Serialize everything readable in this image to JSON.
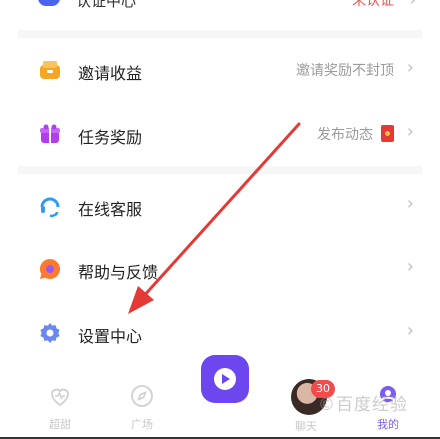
{
  "top_partial": {
    "label": "认证中心",
    "right": "未认证"
  },
  "menu": [
    {
      "key": "invite",
      "label": "邀请收益",
      "value": "邀请奖励不封顶",
      "icon": "wallet-icon",
      "color": "#f5a623"
    },
    {
      "key": "tasks",
      "label": "任务奖励",
      "value": "发布动态",
      "icon": "gift-icon",
      "color": "#b43cf0"
    },
    {
      "key": "service",
      "label": "在线客服",
      "value": "",
      "icon": "headset-icon",
      "color": "#2f9bf0"
    },
    {
      "key": "help",
      "label": "帮助与反馈",
      "value": "",
      "icon": "feedback-icon",
      "color": "#ff7a2e"
    },
    {
      "key": "settings",
      "label": "设置中心",
      "value": "",
      "icon": "gear-icon",
      "color": "#6a86f0"
    }
  ],
  "chevron": "›",
  "tabs": [
    {
      "key": "tab1",
      "label": "超甜",
      "icon": "heart-icon"
    },
    {
      "key": "tab2",
      "label": "广场",
      "icon": "compass-icon"
    },
    {
      "key": "tab4",
      "label": "聊天",
      "icon": "chat-icon",
      "badge": "30"
    },
    {
      "key": "tab5",
      "label": "我的",
      "icon": "profile-icon"
    }
  ],
  "watermark": "©百度经验",
  "annotation_color": "#e53935"
}
